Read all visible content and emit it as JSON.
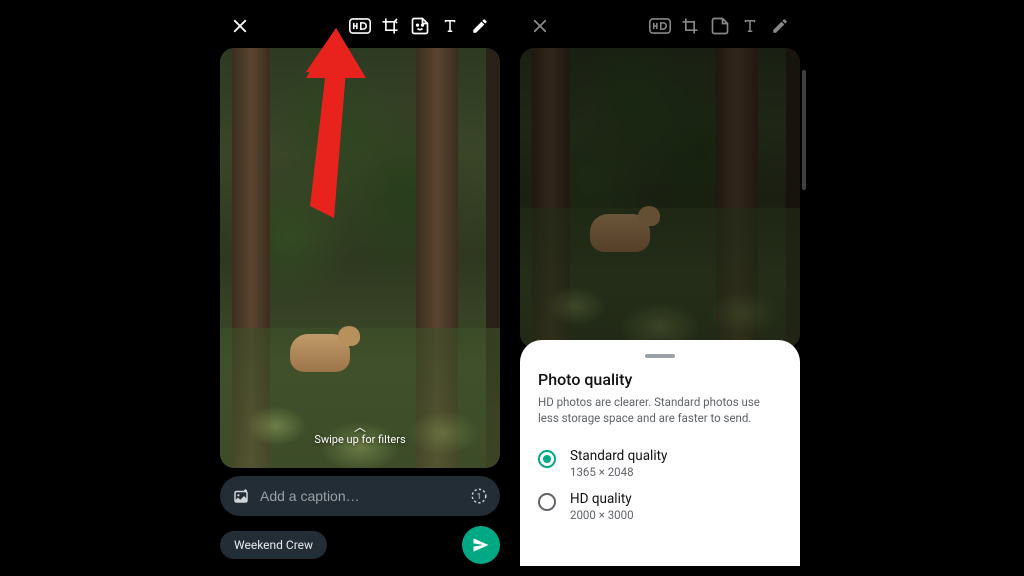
{
  "left": {
    "swipe_hint": "Swipe up for filters",
    "caption_placeholder": "Add a caption…",
    "recipient_chip": "Weekend Crew"
  },
  "right": {
    "sheet": {
      "title": "Photo quality",
      "description": "HD photos are clearer. Standard photos use less storage space and are faster to send.",
      "options": [
        {
          "label": "Standard quality",
          "sub": "1365 × 2048",
          "selected": true
        },
        {
          "label": "HD quality",
          "sub": "2000 × 3000",
          "selected": false
        }
      ]
    }
  },
  "icons": {
    "close": "close",
    "hd": "hd",
    "crop": "crop-rotate",
    "sticker": "sticker",
    "text": "text",
    "draw": "draw",
    "gallery": "gallery-add",
    "view_once": "view-once",
    "send": "send",
    "chevron_up": "chevron-up"
  }
}
